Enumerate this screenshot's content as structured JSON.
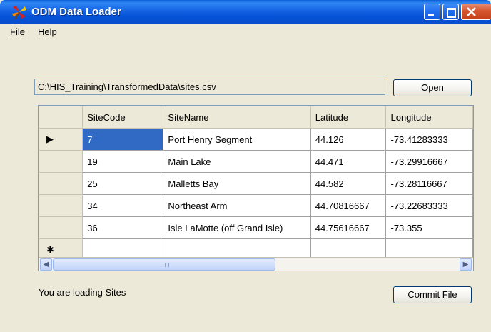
{
  "window": {
    "title": "ODM Data Loader"
  },
  "menu": {
    "items": [
      "File",
      "Help"
    ]
  },
  "file_path": "C:\\HIS_Training\\TransformedData\\sites.csv",
  "buttons": {
    "open": "Open",
    "commit": "Commit File"
  },
  "grid": {
    "columns": [
      "SiteCode",
      "SiteName",
      "Latitude",
      "Longitude"
    ],
    "rows": [
      [
        "7",
        "Port Henry Segment",
        "44.126",
        "-73.41283333"
      ],
      [
        "19",
        "Main Lake",
        "44.471",
        "-73.29916667"
      ],
      [
        "25",
        "Malletts Bay",
        "44.582",
        "-73.28116667"
      ],
      [
        "34",
        "Northeast Arm",
        "44.70816667",
        "-73.22683333"
      ],
      [
        "36",
        "Isle LaMotte (off Grand Isle)",
        "44.75616667",
        "-73.355"
      ]
    ],
    "current_row_marker": "▶",
    "new_row_marker": "✱"
  },
  "status": "You are loading Sites",
  "icons": {
    "app": "pinwheel-icon",
    "minimize": "minimize-icon",
    "maximize": "maximize-icon",
    "close": "close-icon",
    "scroll_left": "scroll-left-icon",
    "scroll_right": "scroll-right-icon"
  },
  "colors": {
    "titlebar": "#0a4fcc",
    "selection": "#316ac5",
    "window_bg": "#ece9d8"
  }
}
